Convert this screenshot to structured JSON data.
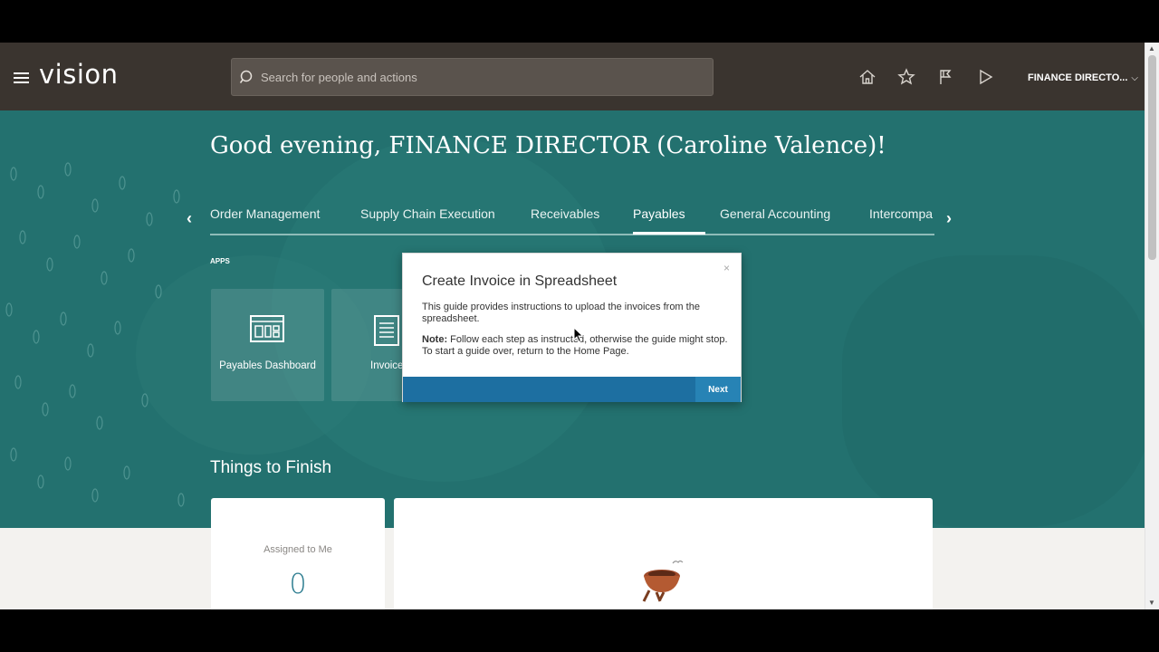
{
  "header": {
    "logo": "vision",
    "search_placeholder": "Search for people and actions",
    "user": "FINANCE DIRECTO...",
    "icons": [
      "home-icon",
      "favorites-star-icon",
      "notifications-flag-icon",
      "sign-out-play-icon"
    ]
  },
  "hero": {
    "greeting": "Good evening, FINANCE DIRECTOR (Caroline Valence)!",
    "tabs": [
      {
        "label": "Order Management"
      },
      {
        "label": "Supply Chain Execution"
      },
      {
        "label": "Receivables"
      },
      {
        "label": "Payables",
        "active": true
      },
      {
        "label": "General Accounting"
      },
      {
        "label": "Intercompa"
      }
    ],
    "apps_label": "APPS",
    "apps": [
      {
        "label": "Payables Dashboard",
        "icon": "dashboard-icon"
      },
      {
        "label": "Invoice",
        "icon": "document-icon"
      }
    ],
    "things_title": "Things to Finish"
  },
  "things": {
    "assigned_label": "Assigned to Me",
    "assigned_count": "0"
  },
  "modal": {
    "title": "Create Invoice in Spreadsheet",
    "body": "This guide provides instructions to upload the invoices from the spreadsheet.",
    "note_label": "Note:",
    "note_text": " Follow each step as instructed, otherwise the guide might stop. To start a guide over, return to the Home Page.",
    "close": "×",
    "next_label": "Next"
  },
  "colors": {
    "topbar": "#3a342f",
    "hero": "#23716f",
    "modal_footer": "#1d6fa1",
    "count": "#2b7c8f"
  }
}
